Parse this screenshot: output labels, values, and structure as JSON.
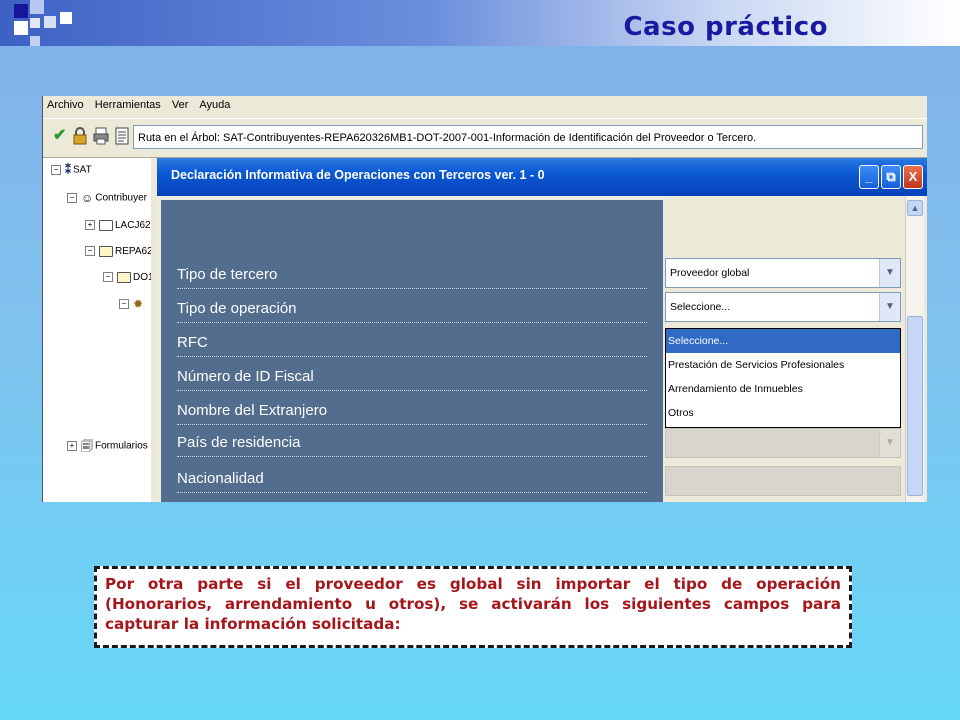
{
  "slide": {
    "title": "Caso práctico",
    "note": "Por otra parte si el proveedor es global sin importar el tipo de operación (Honorarios, arrendamiento u otros), se activarán los siguientes campos para capturar la información solicitada:"
  },
  "menu": [
    "Archivo",
    "Herramientas",
    "Ver",
    "Ayuda"
  ],
  "toolbar": {
    "path": "Ruta en el Árbol: SAT-Contribuyentes-REPA620326MB1-DOT-2007-001-Información de Identificación del Proveedor o Tercero.",
    "icons": [
      "check-icon",
      "lock-icon",
      "print-icon",
      "document-icon"
    ]
  },
  "tree": {
    "sat": "SAT",
    "contribuyentes": "Contribuyer",
    "lacj": "LACJ62",
    "repa": "REPA62",
    "dot": "DO1",
    "formularios": "Formularios"
  },
  "dialog": {
    "title": "Declaración Informativa de Operaciones con Terceros ver. 1 - 0",
    "buttons": [
      "_",
      "⧉",
      "X"
    ]
  },
  "form": {
    "fields": [
      "Tipo de tercero",
      "Tipo de operación",
      "RFC",
      "Número de ID Fiscal",
      "Nombre del Extranjero",
      "País de residencia",
      "Nacionalidad"
    ],
    "tipo_tercero_value": "Proveedor global",
    "tipo_operacion_value": "Seleccione...",
    "dropdown_options": [
      "Seleccione...",
      "Prestación de Servicios Profesionales",
      "Arrendamiento  de Inmuebles",
      "Otros"
    ],
    "dropdown_selected": "Seleccione..."
  },
  "colors": {
    "title": "#1a1a9e",
    "note_text": "#a5161b",
    "form_panel": "#526d8e",
    "titlebar": "#0b58d4",
    "selection": "#316ac5"
  }
}
